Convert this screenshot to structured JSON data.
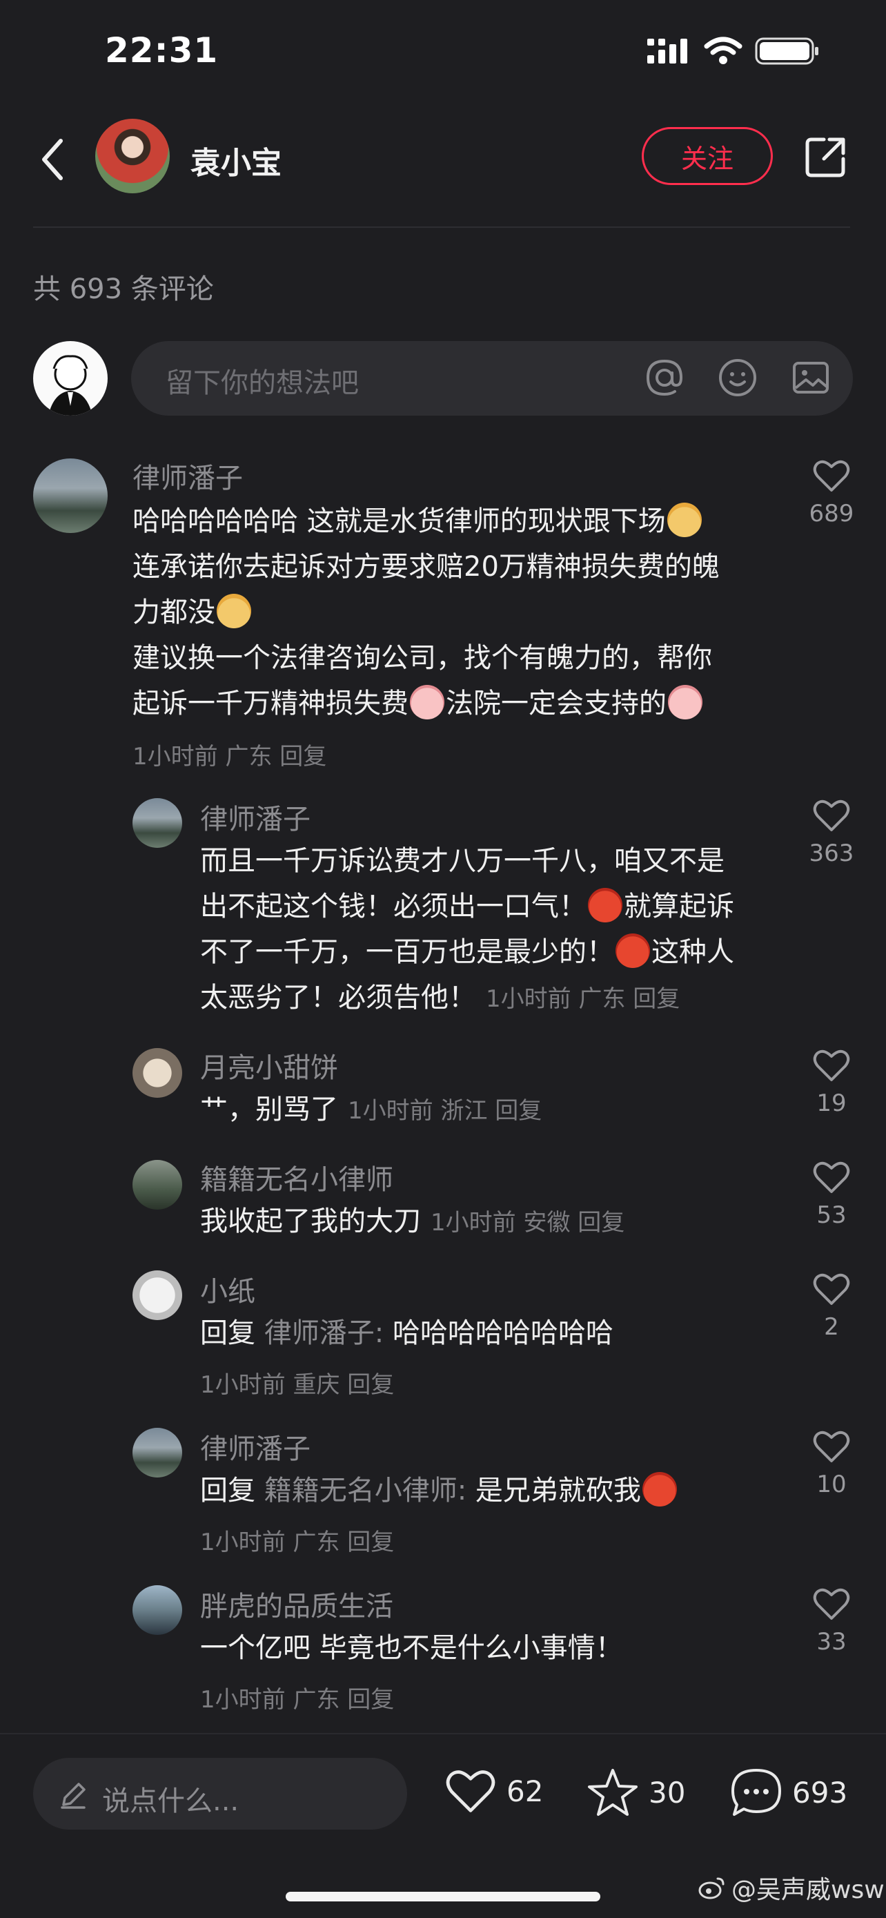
{
  "status_bar": {
    "time": "22:31"
  },
  "header": {
    "author_name": "袁小宝",
    "follow_label": "关注"
  },
  "comments_count_label": "共 693 条评论",
  "input": {
    "placeholder": "留下你的想法吧"
  },
  "comments": [
    {
      "name": "律师潘子",
      "lines": [
        [
          "哈哈哈哈哈哈 这就是水货律师的现状跟下场",
          "emoji-face"
        ],
        [
          "连承诺你去起诉对方要求赔20万精神损失费的魄"
        ],
        [
          "力都没",
          "emoji-face"
        ],
        [
          "建议换一个法律咨询公司，找个有魄力的，帮你"
        ],
        [
          "起诉一千万精神损失费",
          "emoji-pig",
          "法院一定会支持的",
          "emoji-pig"
        ]
      ],
      "meta": "1小时前 广东 回复",
      "likes": "689"
    }
  ],
  "replies": [
    {
      "name": "律师潘子",
      "line1": "而且一千万诉讼费才八万一千八，咱又不是",
      "line2a": "出不起这个钱！必须出一口气！",
      "line2b": "就算起诉",
      "line3a": "不了一千万，一百万也是最少的！",
      "line3b": "这种人",
      "line4": "太恶劣了！必须告他！",
      "meta": "1小时前 广东 回复",
      "likes": "363"
    },
    {
      "name": "月亮小甜饼",
      "text": "艹，别骂了",
      "meta": "1小时前 浙江 回复",
      "likes": "19"
    },
    {
      "name": "籍籍无名小律师",
      "text": "我收起了我的大刀",
      "meta": "1小时前 安徽 回复",
      "likes": "53"
    },
    {
      "name": "小纸",
      "reply_prefix": "回复",
      "reply_to": "律师潘子:",
      "text": "哈哈哈哈哈哈哈哈",
      "meta": "1小时前 重庆 回复",
      "likes": "2"
    },
    {
      "name": "律师潘子",
      "reply_prefix": "回复",
      "reply_to": "籍籍无名小律师:",
      "text": "是兄弟就砍我",
      "meta": "1小时前 广东 回复",
      "likes": "10"
    },
    {
      "name": "胖虎的品质生活",
      "text": "一个亿吧 毕竟也不是什么小事情！",
      "meta": "1小时前 广东 回复",
      "likes": "33"
    }
  ],
  "bottom_bar": {
    "say_placeholder": "说点什么...",
    "likes": "62",
    "stars": "30",
    "comments": "693"
  },
  "watermark": "@吴声威wsw",
  "colors": {
    "background": "#1e1e21",
    "accent": "#ff2e4d",
    "muted": "#8c8c90"
  }
}
